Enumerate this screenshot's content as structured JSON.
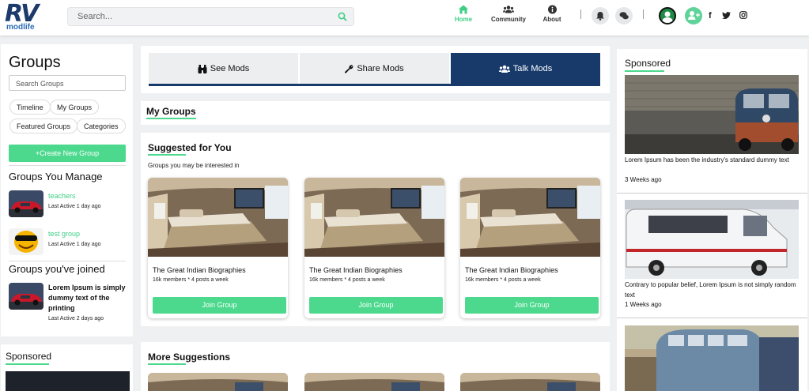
{
  "header": {
    "logo_text": "RV",
    "brand": "modlife",
    "search_placeholder": "Search...",
    "nav": [
      {
        "label": "Home",
        "icon": "home-icon",
        "active": true
      },
      {
        "label": "Community",
        "icon": "users-icon",
        "active": false
      },
      {
        "label": "About",
        "icon": "info-icon",
        "active": false
      }
    ],
    "social": [
      "f",
      "twitter-icon",
      "instagram-icon"
    ],
    "accent": "#4cd98d",
    "primary": "#173a6b"
  },
  "left": {
    "title": "Groups",
    "search_placeholder": "Search Groups",
    "pills": [
      "Timeline",
      "My Groups",
      "Featured Groups",
      "Categories"
    ],
    "create_label": "+Create New Group",
    "manage_title": "Groups You Manage",
    "managed": [
      {
        "name": "teachers",
        "meta": "Last Active 1 day ago"
      },
      {
        "name": "test group",
        "meta": "Last Active 1 day ago"
      }
    ],
    "joined_title": "Groups you've joined",
    "joined": [
      {
        "name": "Lorem Ipsum is simply dummy text of the printing",
        "meta": "Last Active 2 days ago"
      }
    ],
    "sponsored_title": "Sponsored"
  },
  "tabs": [
    {
      "label": "See Mods",
      "icon": "binoculars-icon",
      "active": false
    },
    {
      "label": "Share Mods",
      "icon": "wrench-icon",
      "active": false
    },
    {
      "label": "Talk Mods",
      "icon": "users-icon",
      "active": true
    }
  ],
  "my_groups_title": "My Groups",
  "suggested": {
    "title": "Suggested for You",
    "subtitle": "Groups you may be interested in",
    "cards": [
      {
        "name": "The Great Indian Biographies",
        "meta": "16k members * 4 posts a week",
        "button": "Join Group"
      },
      {
        "name": "The Great Indian Biographies",
        "meta": "16k members * 4 posts a week",
        "button": "Join Group"
      },
      {
        "name": "The Great Indian Biographies",
        "meta": "16k members * 4 posts a week",
        "button": "Join Group"
      }
    ]
  },
  "more_title": "More Suggestions",
  "right": {
    "title": "Sponsored",
    "items": [
      {
        "text": "Lorem Ipsum has been the industry's standard dummy text",
        "date": "3 Weeks ago"
      },
      {
        "text": "Contrary to popular belief, Lorem Ipsum is not simply random text",
        "date": "1 Weeks ago"
      }
    ]
  }
}
